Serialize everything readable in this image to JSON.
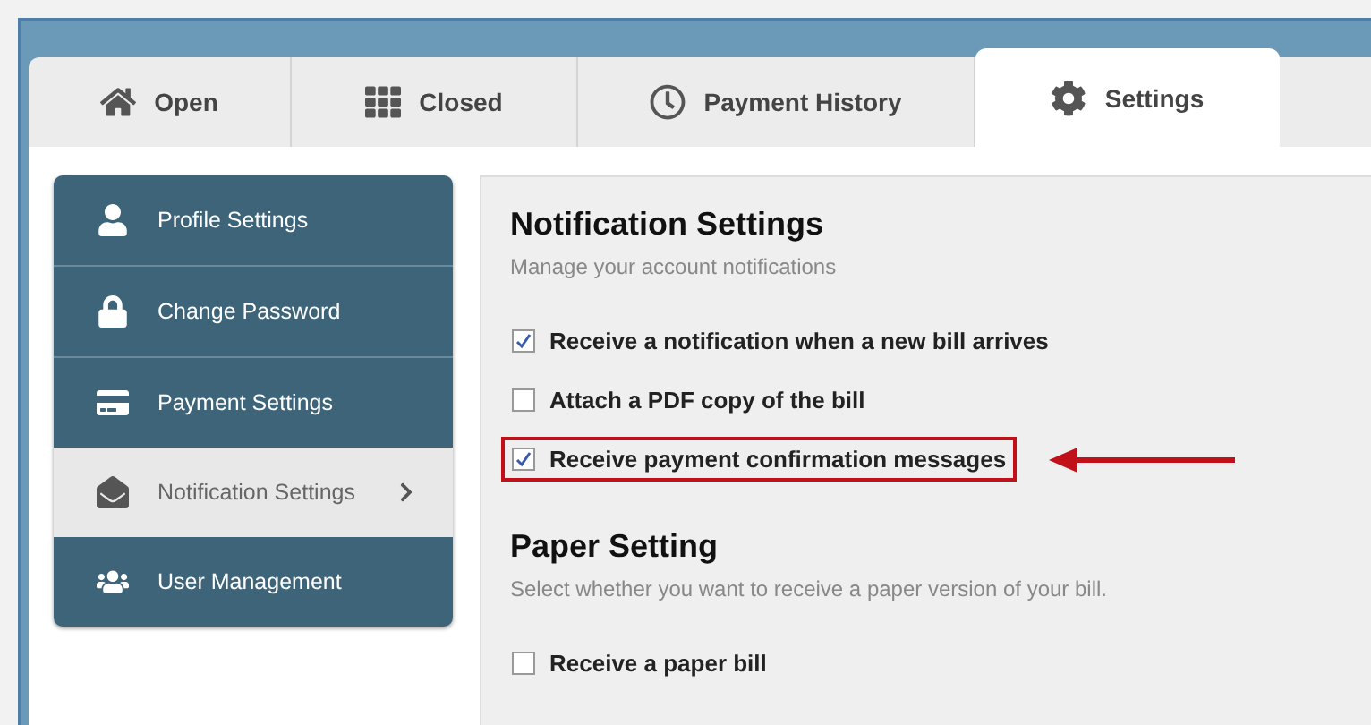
{
  "tabs": [
    {
      "label": "Open",
      "selected": false
    },
    {
      "label": "Closed",
      "selected": false
    },
    {
      "label": "Payment History",
      "selected": false
    },
    {
      "label": "Settings",
      "selected": true
    }
  ],
  "sidebar": {
    "items": [
      {
        "label": "Profile Settings",
        "selected": false
      },
      {
        "label": "Change Password",
        "selected": false
      },
      {
        "label": "Payment Settings",
        "selected": false
      },
      {
        "label": "Notification Settings",
        "selected": true
      },
      {
        "label": "User Management",
        "selected": false
      }
    ]
  },
  "sections": [
    {
      "title": "Notification Settings",
      "subtitle": "Manage your account notifications",
      "options": [
        {
          "label": "Receive a notification when a new bill arrives",
          "checked": true,
          "highlighted": false
        },
        {
          "label": "Attach a PDF copy of the bill",
          "checked": false,
          "highlighted": false
        },
        {
          "label": "Receive payment confirmation messages",
          "checked": true,
          "highlighted": true
        }
      ]
    },
    {
      "title": "Paper Setting",
      "subtitle": "Select whether you want to receive a paper version of your bill.",
      "options": [
        {
          "label": "Receive a paper bill",
          "checked": false,
          "highlighted": false
        }
      ]
    }
  ]
}
